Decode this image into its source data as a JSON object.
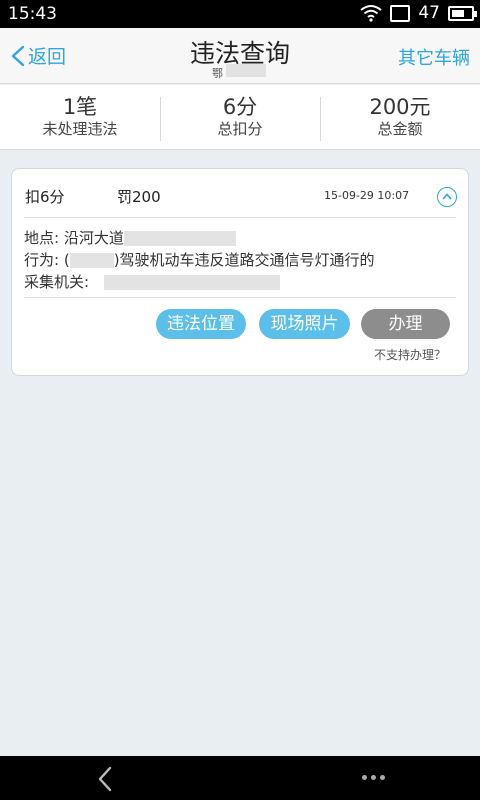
{
  "status": {
    "time": "15:43",
    "battery": "47"
  },
  "header": {
    "back_label": "返回",
    "title": "违法查询",
    "plate_prefix": "鄂",
    "other_vehicles": "其它车辆"
  },
  "summary": [
    {
      "value": "1笔",
      "label": "未处理违法"
    },
    {
      "value": "6分",
      "label": "总扣分"
    },
    {
      "value": "200元",
      "label": "总金额"
    }
  ],
  "violation": {
    "points": "扣6分",
    "fine": "罚200",
    "time": "15-09-29 10:07",
    "location_label": "地点:",
    "location_value": "沿河大道",
    "behavior_label": "行为:",
    "behavior_prefix": "(",
    "behavior_text": ")驾驶机动车违反道路交通信号灯通行的",
    "agency_label": "采集机关:",
    "buttons": {
      "location": "违法位置",
      "photos": "现场照片",
      "handle": "办理"
    },
    "unsupported": "不支持办理？"
  }
}
